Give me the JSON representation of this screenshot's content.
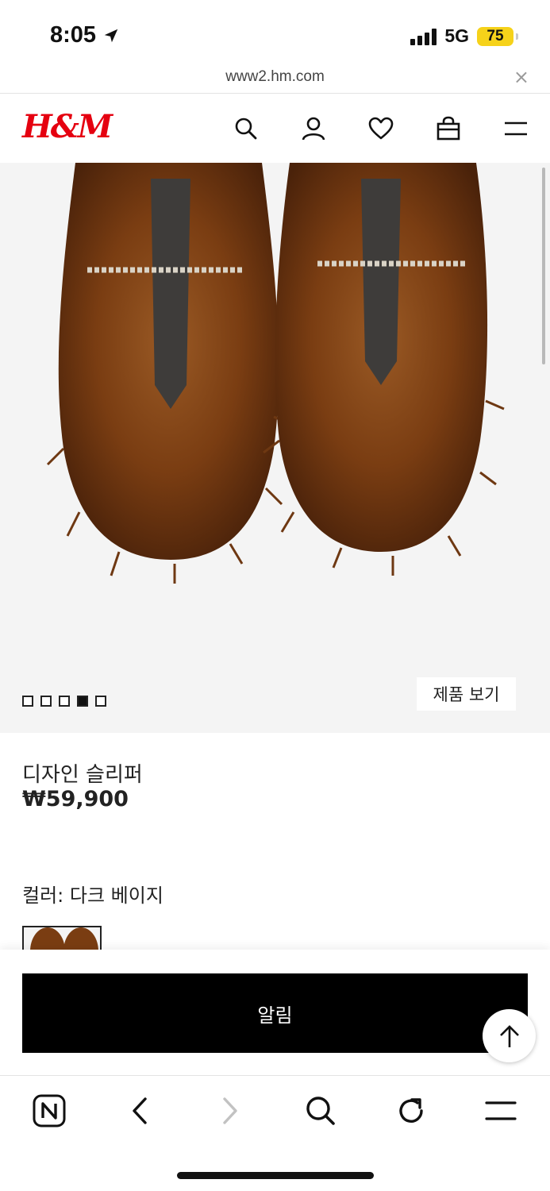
{
  "status_bar": {
    "time": "8:05",
    "network": "5G",
    "battery": "75",
    "battery_color": "#f6d21a"
  },
  "browser": {
    "url": "www2.hm.com",
    "close_label": "×"
  },
  "header": {
    "logo": "H&M",
    "brand_color": "#e50010",
    "icons": [
      "search-icon",
      "account-icon",
      "heart-icon",
      "bag-icon",
      "menu-icon"
    ]
  },
  "gallery": {
    "image_count": 5,
    "active_index": 3,
    "view_button": "제품 보기"
  },
  "product": {
    "name": "디자인 슬리퍼",
    "price": "₩59,900",
    "color_label": "컬러: 다크 베이지"
  },
  "actions": {
    "notify_button": "알림"
  },
  "toolbar": {
    "icons": [
      "naver-icon",
      "back-icon",
      "forward-icon",
      "search-icon",
      "reload-icon",
      "menu-icon"
    ]
  }
}
